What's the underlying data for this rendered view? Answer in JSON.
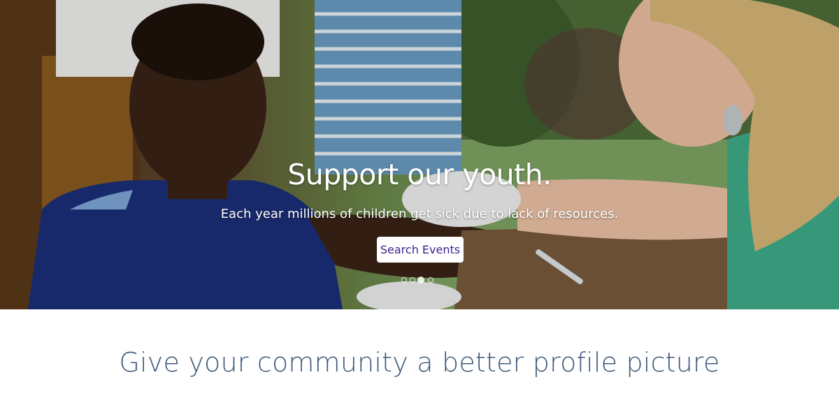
{
  "hero": {
    "title": "Support our youth.",
    "subtitle": "Each year millions of children get sick due to lack of resources.",
    "cta_label": "Search Events",
    "carousel": {
      "slide_count": 4,
      "active_index": 2
    }
  },
  "section": {
    "heading": "Give your community a better profile picture"
  },
  "colors": {
    "cta_text": "#3b1f8e",
    "heading": "#3f5a7a"
  }
}
